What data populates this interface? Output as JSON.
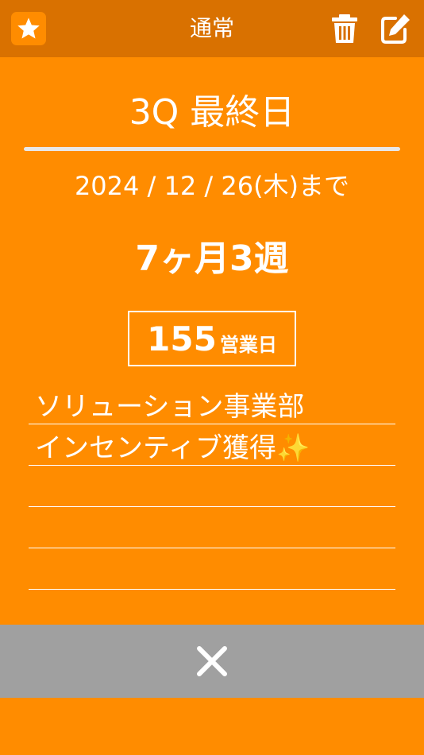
{
  "header": {
    "title": "通常",
    "icons": [
      "star-icon",
      "trash-icon",
      "edit-icon"
    ]
  },
  "event": {
    "title": "3Q  最終日",
    "deadline": "2024 / 12 / 26(木)まで",
    "remaining": "7ヶ月3週",
    "business_days": "155",
    "business_days_unit": "営業日"
  },
  "notes": {
    "lines": [
      "ソリューション事業部",
      "インセンティブ獲得✨",
      "",
      "",
      ""
    ]
  },
  "footer": {
    "close_icon": "close-icon"
  },
  "colors": {
    "background": "#FF8C00",
    "header": "#D97100",
    "close_bar": "#A0A0A0",
    "text": "#FFFFFF"
  }
}
